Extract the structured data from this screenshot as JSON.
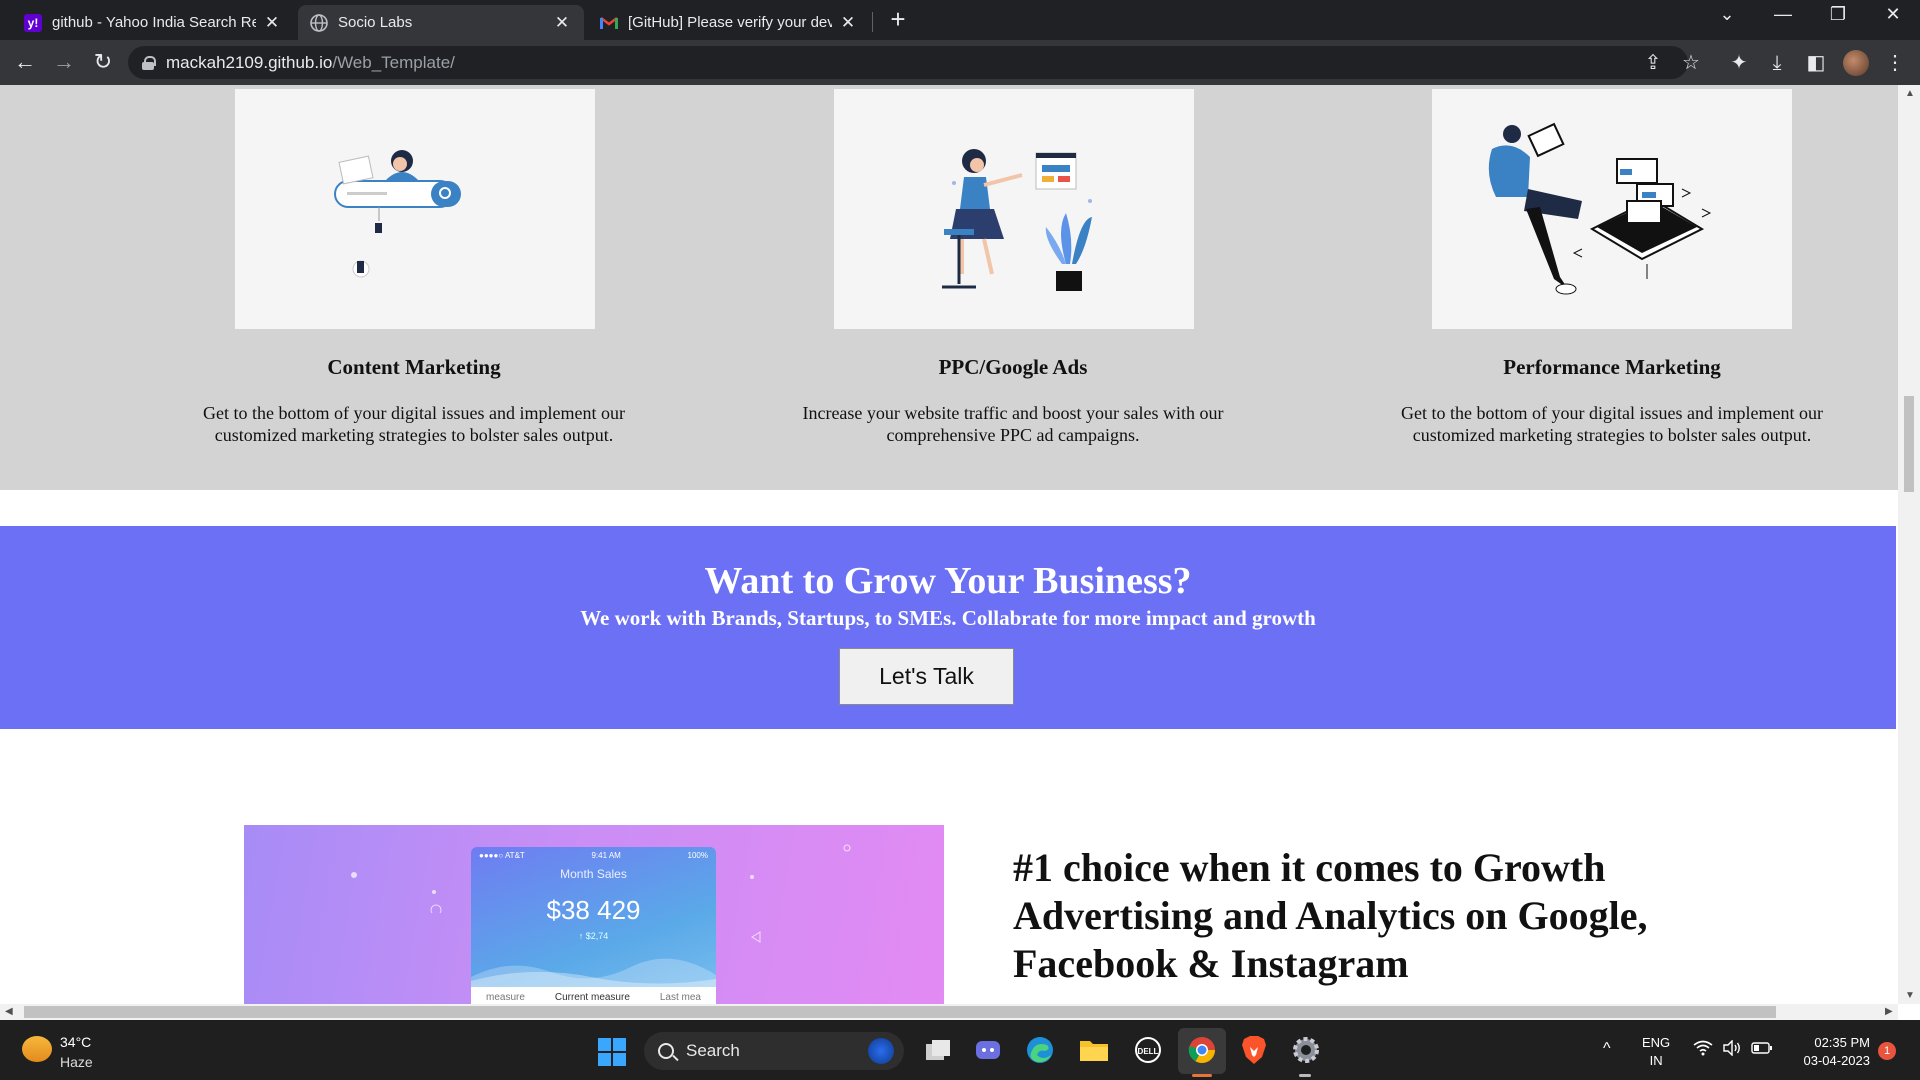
{
  "browser": {
    "tabs": [
      {
        "title": "github - Yahoo India Search Resu",
        "favicon": "yahoo-icon"
      },
      {
        "title": "Socio Labs",
        "favicon": "globe-icon"
      },
      {
        "title": "[GitHub] Please verify your devic",
        "favicon": "gmail-icon"
      }
    ],
    "active_tab": 1,
    "new_tab_label": "+",
    "url_host": "mackah2109.github.io",
    "url_path": "/Web_Template/"
  },
  "services": [
    {
      "title": "Content Marketing",
      "description": "Get to the bottom of your digital issues and implement our customized marketing strategies to bolster sales output."
    },
    {
      "title": "PPC/Google Ads",
      "description": "Increase your website traffic and boost your sales with our comprehensive PPC ad campaigns."
    },
    {
      "title": "Performance Marketing",
      "description": "Get to the bottom of your digital issues and implement our customized marketing strategies to bolster sales output."
    }
  ],
  "cta": {
    "title": "Want to Grow Your Business?",
    "subtitle": "We work with Brands, Startups, to SMEs. Collabrate for more impact and growth",
    "button": "Let's Talk"
  },
  "growth": {
    "phone_carrier": "●●●●○ AT&T",
    "phone_time": "9:41 AM",
    "phone_battery": "100%",
    "phone_heading": "Month Sales",
    "phone_amount": "$38 429",
    "phone_delta": "↑ $2,74",
    "phone_tabs": [
      "measure",
      "Current measure",
      "Last mea"
    ],
    "title": "#1 choice when it comes to Growth Advertising and Analytics on Google, Facebook & Instagram"
  },
  "taskbar": {
    "temperature": "34°C",
    "condition": "Haze",
    "search_label": "Search",
    "lang_line1": "ENG",
    "lang_line2": "IN",
    "time": "02:35 PM",
    "date": "03-04-2023",
    "notification_count": "1"
  },
  "colors": {
    "services_bg": "#d3d3d3",
    "cta_bg": "#6b70f5",
    "card_bg": "#f5f5f5"
  }
}
